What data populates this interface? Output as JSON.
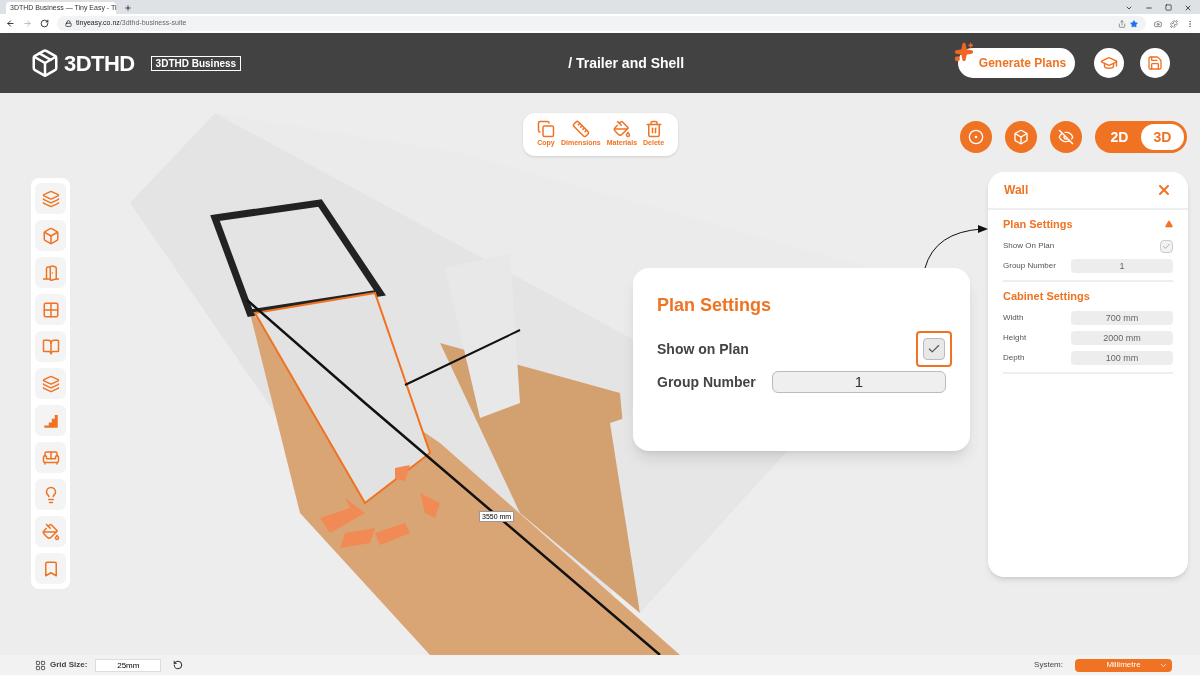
{
  "browser": {
    "tab_title": "3DTHD Business — Tiny Easy - Ti",
    "url_host": "tinyeasy.co.nz",
    "url_path": "/3dthd-business-suite"
  },
  "header": {
    "logo_text": "3DTHD",
    "badge": "3DTHD Business",
    "breadcrumb": "/ Trailer and Shell",
    "generate_button": "Generate Plans"
  },
  "toolbar": [
    {
      "label": "Copy"
    },
    {
      "label": "Dimensions"
    },
    {
      "label": "Materials"
    },
    {
      "label": "Delete"
    }
  ],
  "view_toggle": [
    {
      "label": "2D",
      "selected": false
    },
    {
      "label": "3D",
      "selected": true
    }
  ],
  "scene": {
    "dimension_label": "3550 mm"
  },
  "popup": {
    "title": "Plan Settings",
    "show_on_plan": {
      "label": "Show on Plan",
      "checked": true
    },
    "group_number": {
      "label": "Group Number",
      "value": "1"
    }
  },
  "panel": {
    "title": "Wall",
    "sections": [
      {
        "title": "Plan Settings",
        "rows": [
          {
            "kind": "checkbox",
            "label": "Show On Plan",
            "checked": true
          },
          {
            "kind": "field",
            "label": "Group Number",
            "value": "1"
          }
        ]
      },
      {
        "title": "Cabinet Settings",
        "rows": [
          {
            "kind": "field",
            "label": "Width",
            "value": "700 mm"
          },
          {
            "kind": "field",
            "label": "Height",
            "value": "2000 mm"
          },
          {
            "kind": "field",
            "label": "Depth",
            "value": "100 mm"
          }
        ]
      }
    ]
  },
  "footer": {
    "grid_label": "Grid Size:",
    "grid_value": "25mm",
    "system_label": "System:",
    "system_value": "Millimetre"
  }
}
